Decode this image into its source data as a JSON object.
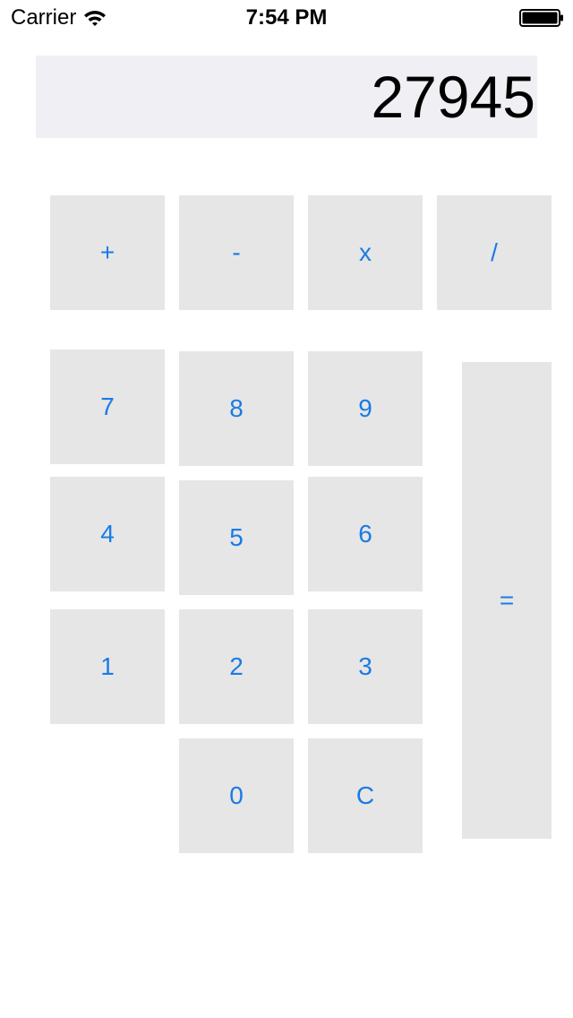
{
  "status_bar": {
    "carrier": "Carrier",
    "time": "7:54 PM",
    "wifi_icon": "wifi-icon",
    "battery_icon": "battery-icon"
  },
  "display": {
    "value": "27945"
  },
  "colors": {
    "key_background": "#e6e6e6",
    "key_text": "#1a7be6",
    "display_background": "#efeff4"
  },
  "keys": {
    "plus": "+",
    "minus": "-",
    "multiply": "x",
    "divide": "/",
    "seven": "7",
    "eight": "8",
    "nine": "9",
    "four": "4",
    "five": "5",
    "six": "6",
    "one": "1",
    "two": "2",
    "three": "3",
    "zero": "0",
    "clear": "C",
    "equals": "="
  }
}
